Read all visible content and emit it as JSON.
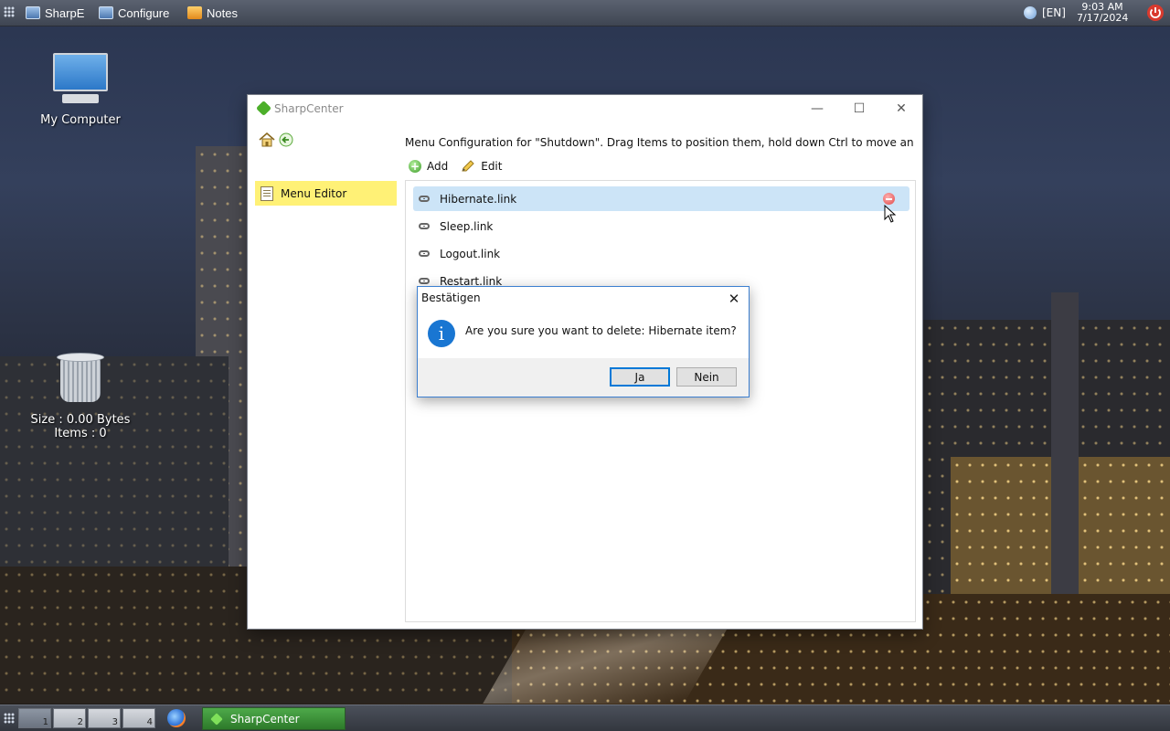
{
  "topbar": {
    "items": [
      {
        "label": "SharpE",
        "icon": "monitor-icon"
      },
      {
        "label": "Configure",
        "icon": "monitor-icon"
      },
      {
        "label": "Notes",
        "icon": "notes-icon"
      }
    ],
    "language": "[EN]",
    "time": "9:03 AM",
    "date": "7/17/2024",
    "power_icon": "power-icon"
  },
  "desktop": {
    "computer_label": "My Computer",
    "recycle_size": "Size : 0.00 Bytes",
    "recycle_items": "Items : 0"
  },
  "window": {
    "title": "SharpCenter",
    "nav": {
      "selected": "Menu Editor"
    },
    "description": "Menu Configuration for \"Shutdown\". Drag Items to position them, hold down Ctrl to move an item into...",
    "toolbar": {
      "add": "Add",
      "edit": "Edit"
    },
    "items": [
      "Hibernate.link",
      "Sleep.link",
      "Logout.link",
      "Restart.link"
    ],
    "selected_index": 0
  },
  "dialog": {
    "title": "Bestätigen",
    "message": "Are you sure you want to delete: Hibernate item?",
    "yes": "Ja",
    "no": "Nein"
  },
  "taskbar": {
    "pagers": [
      "1",
      "2",
      "3",
      "4"
    ],
    "active_pager": "1",
    "task": "SharpCenter"
  },
  "colors": {
    "selection": "#cce4f7",
    "nav_highlight": "#fff176",
    "dialog_accent": "#0078d7",
    "task_button": "#3e8f3a"
  }
}
